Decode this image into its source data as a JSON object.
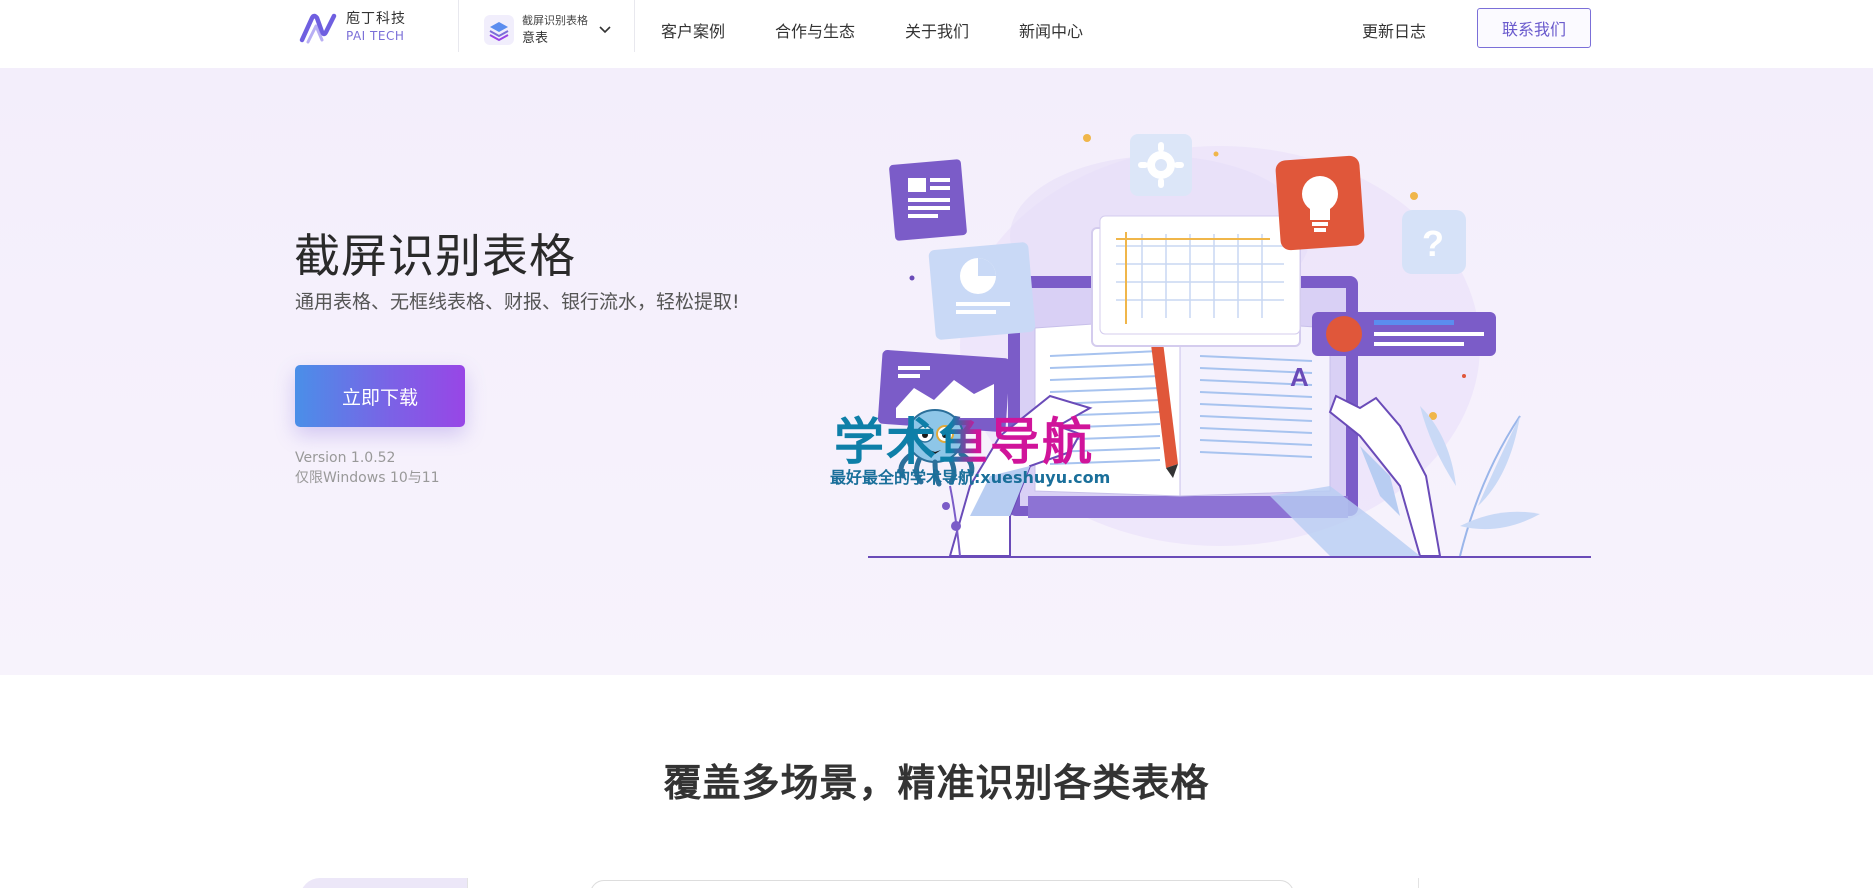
{
  "header": {
    "logo_cn": "庖丁科技",
    "logo_en": "PAI TECH",
    "product_sub": "截屏识别表格",
    "product_name": "意表",
    "nav": [
      "客户案例",
      "合作与生态",
      "关于我们",
      "新闻中心"
    ],
    "changelog": "更新日志",
    "contact": "联系我们"
  },
  "hero": {
    "title": "截屏识别表格",
    "subtitle": "通用表格、无框线表格、财报、银行流水，轻松提取!",
    "download": "立即下载",
    "version": "Version 1.0.52",
    "os": "仅限Windows 10与11"
  },
  "watermark": {
    "title": "学术鱼导航",
    "subtitle": "最好最全的学术导航:xueshuyu.com"
  },
  "section": {
    "title": "覆盖多场景，精准识别各类表格"
  },
  "colors": {
    "accent": "#7b6fd8",
    "download_gradient_start": "#4a8fe8",
    "download_gradient_end": "#9846e6",
    "hero_bg": "#f3eefb"
  },
  "icons": [
    "logo-icon",
    "product-icon",
    "chevron-down-icon",
    "gear-icon",
    "lightbulb-icon",
    "question-icon",
    "document-icon",
    "chart-icon",
    "octopus-icon"
  ]
}
